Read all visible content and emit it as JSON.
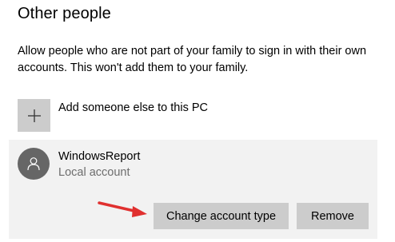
{
  "section": {
    "title": "Other people",
    "description": "Allow people who are not part of your family to sign in with their own accounts. This won't add them to your family."
  },
  "add_user": {
    "label": "Add someone else to this PC",
    "icon": "plus-icon"
  },
  "account": {
    "name": "WindowsReport",
    "type": "Local account",
    "icon": "person-icon"
  },
  "actions": {
    "change_type_label": "Change account type",
    "remove_label": "Remove"
  },
  "colors": {
    "tile": "#cccccc",
    "panel": "#f2f2f2",
    "avatar": "#666666",
    "secondary_text": "#6d6d6d",
    "annotation_arrow": "#e0302f"
  }
}
